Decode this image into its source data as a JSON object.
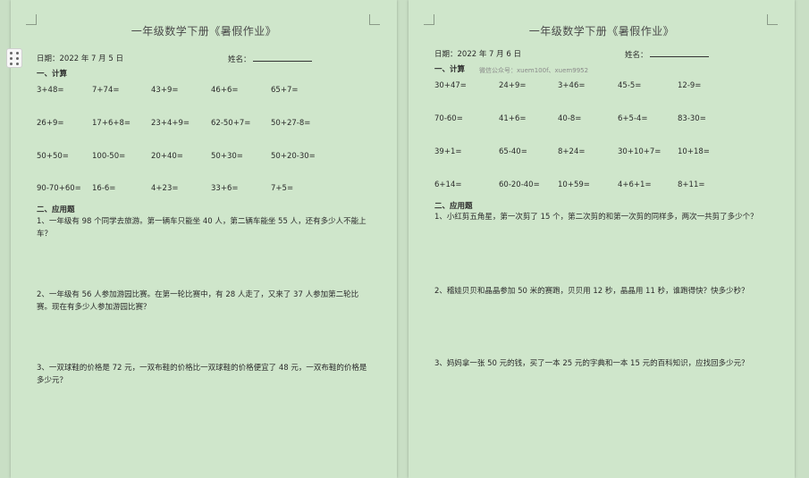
{
  "page1": {
    "title": "一年级数学下册《暑假作业》",
    "date": "日期：2022 年 7 月 5 日",
    "name_label": "姓名：",
    "section1": "一、计算",
    "calc_rows": [
      [
        "3+48=",
        "7+74=",
        "43+9=",
        "46+6=",
        "65+7="
      ],
      [
        "26+9=",
        "17+6+8=",
        "23+4+9=",
        "62-50+7=",
        "50+27-8="
      ],
      [
        "50+50=",
        "100-50=",
        "20+40=",
        "50+30=",
        "50+20-30="
      ],
      [
        "90-70+60=",
        "16-6=",
        "4+23=",
        "33+6=",
        "7+5="
      ]
    ],
    "section2": "二、应用题",
    "problems": [
      "1、一年级有 98 个同学去旅游。第一辆车只能坐 40 人，第二辆车能坐 55 人，还有多少人不能上车？",
      "2、一年级有 56 人参加游园比赛。在第一轮比赛中，有 28 人走了，又来了 37 人参加第二轮比赛。现在有多少人参加游园比赛？",
      "3、一双球鞋的价格是 72 元，一双布鞋的价格比一双球鞋的价格便宜了 48 元，一双布鞋的价格是多少元？"
    ]
  },
  "page2": {
    "title": "一年级数学下册《暑假作业》",
    "date": "日期：2022 年 7 月 6 日",
    "name_label": "姓名：",
    "section1": "一、计算",
    "watermark": "微信公众号：xuem100f、xuem9952",
    "calc_rows": [
      [
        "30+47=",
        "24+9=",
        "3+46=",
        "45-5=",
        "12-9="
      ],
      [
        "70-60=",
        "41+6=",
        "40-8=",
        "6+5-4=",
        "83-30="
      ],
      [
        "39+1=",
        "65-40=",
        "8+24=",
        "30+10+7=",
        "10+18="
      ],
      [
        "6+14=",
        "60-20-40=",
        "10+59=",
        "4+6+1=",
        "8+11="
      ]
    ],
    "section2": "二、应用题",
    "problems": [
      "1、小红剪五角星，第一次剪了 15 个，第二次剪的和第一次剪的同样多，两次一共剪了多少个？",
      "2、稽娃贝贝和晶晶参加 50 米的赛跑，贝贝用 12 秒，晶晶用 11 秒，谁跑得快？快多少秒？",
      "3、妈妈拿一张 50 元的钱，买了一本 25 元的字典和一本 15 元的百科知识，应找回多少元？"
    ]
  }
}
